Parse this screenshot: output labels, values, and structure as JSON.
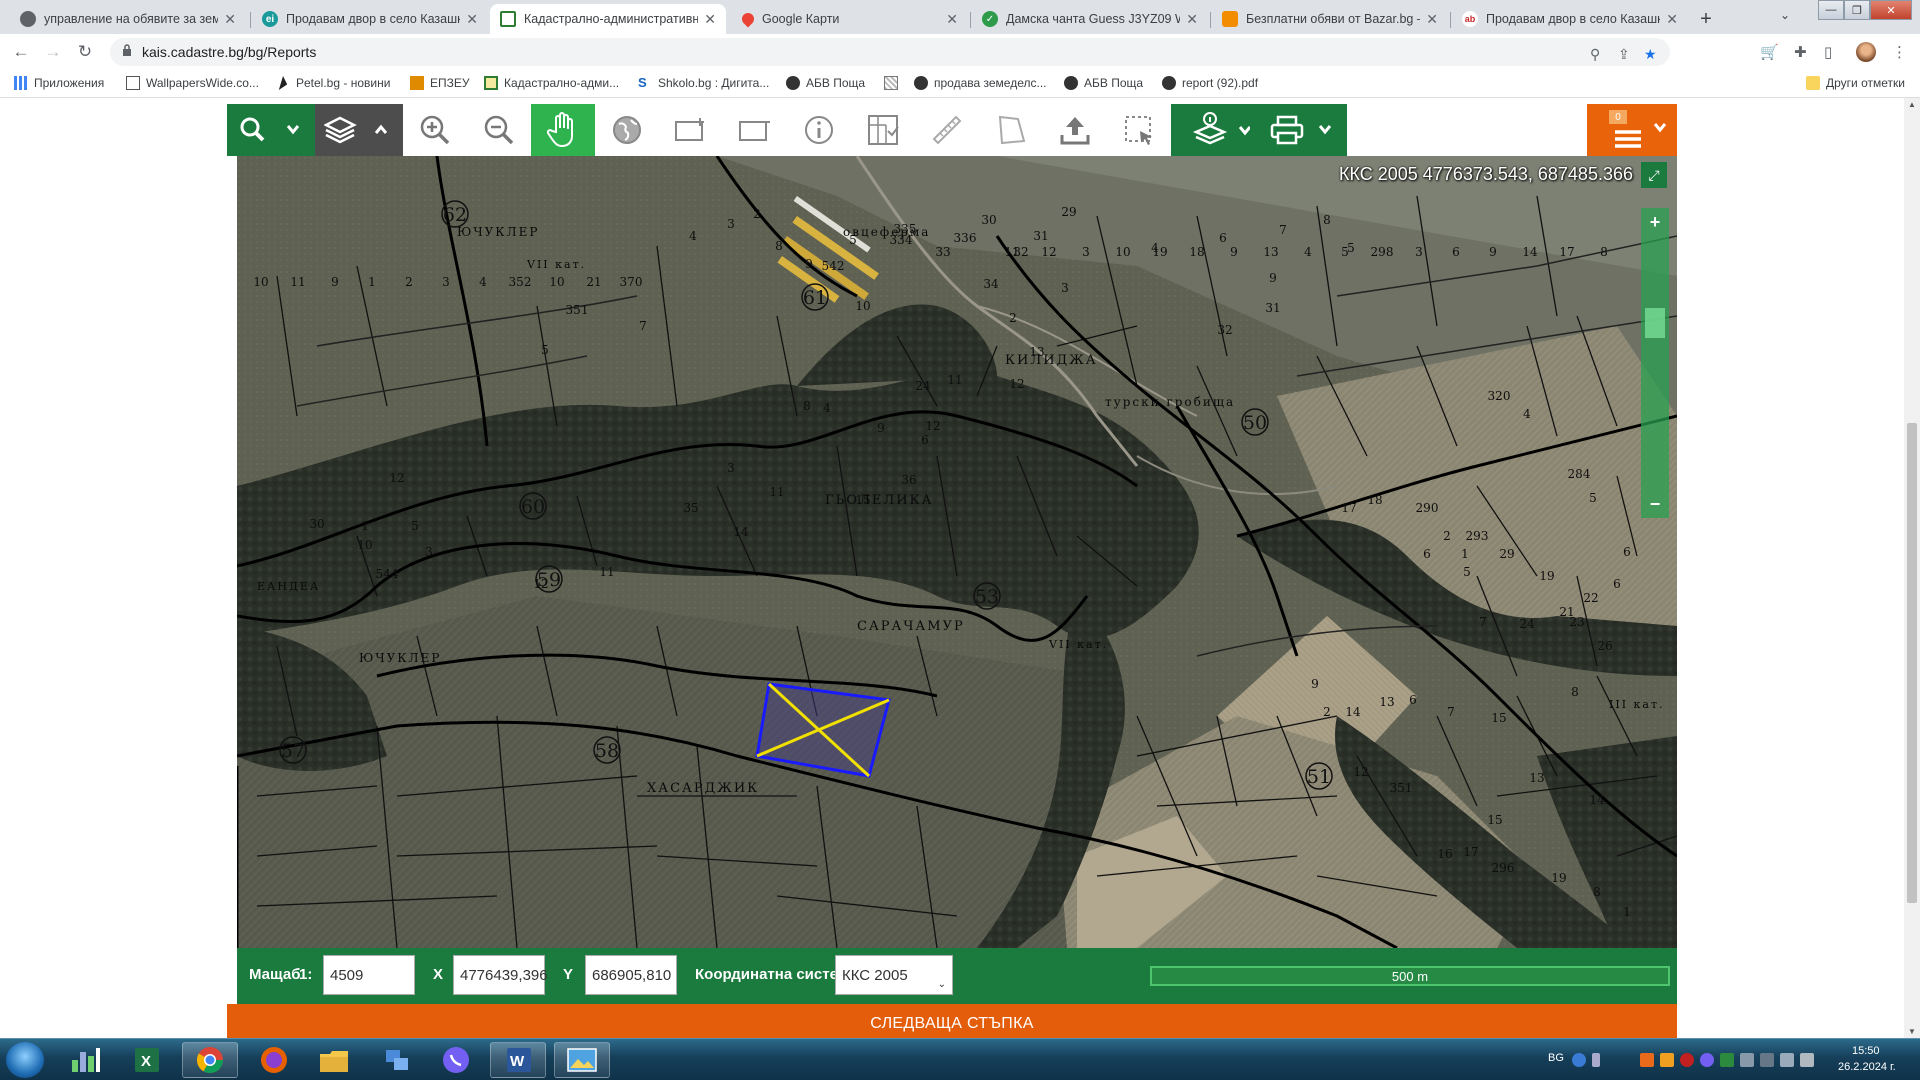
{
  "browser": {
    "tabs": [
      {
        "title": "управление на обявите за земе",
        "favicon_color": "#5f6368",
        "active": false
      },
      {
        "title": "Продавам двор в село Казашка",
        "favicon_color": "#1a9a9a",
        "active": false
      },
      {
        "title": "Кадастрално-административна",
        "favicon_color": "#2e7d32",
        "active": true
      },
      {
        "title": "Google Карти",
        "favicon_color": "#ea4335",
        "active": false
      },
      {
        "title": "Дамска чанта Guess J3YZ09 WF",
        "favicon_color": "#2e9b4a",
        "active": false
      },
      {
        "title": "Безплатни обяви от Bazar.bg – с",
        "favicon_color": "#f28c00",
        "active": false
      },
      {
        "title": "Продавам двор в село Казашка",
        "favicon_color": "#c62828",
        "active": false
      }
    ],
    "new_tab": "+",
    "url": "kais.cadastre.bg/bg/Reports",
    "bookmarks": [
      {
        "label": "Приложения",
        "color": "#4285f4"
      },
      {
        "label": "WallpapersWide.co...",
        "color": "#555555"
      },
      {
        "label": "Petel.bg - новини",
        "color": "#222222"
      },
      {
        "label": "ЕПЗЕУ",
        "color": "#e08a00"
      },
      {
        "label": "Кадастрално-адми...",
        "color": "#2e7d32"
      },
      {
        "label": "Shkolo.bg : Дигита...",
        "color": "#1565c0"
      },
      {
        "label": "АБВ Поща",
        "color": "#333333"
      },
      {
        "label": "",
        "color": "#777777"
      },
      {
        "label": "продава земеделс...",
        "color": "#333333"
      },
      {
        "label": "АБВ Поща",
        "color": "#333333"
      },
      {
        "label": "report (92).pdf",
        "color": "#333333"
      }
    ],
    "other_bookmarks": "Други отметки"
  },
  "map": {
    "toolbar_counter": "0",
    "coordinate_readout": "ККС 2005 4776373.543, 687485.366",
    "zoom_in": "+",
    "zoom_out": "−",
    "labels": [
      {
        "t": "ЮЧУКЛЕР"
      },
      {
        "t": "VII кат."
      },
      {
        "t": "овцеферма"
      },
      {
        "t": "КИЛИДЖА"
      },
      {
        "t": "турски гробища"
      },
      {
        "t": "ГЬОЛЕЛИКА"
      },
      {
        "t": "САРАЧАМУР"
      },
      {
        "t": "ЮЧУКЛЕР"
      },
      {
        "t": "ХАСАРДЖИК"
      },
      {
        "t": "VII кат."
      },
      {
        "t": "III кат."
      },
      {
        "t": "ЕАНДЕА"
      }
    ],
    "block_numbers": [
      "62",
      "61",
      "60",
      "59",
      "50",
      "53",
      "58",
      "57",
      "51"
    ],
    "parcel_numbers": [
      {
        "t": "2"
      },
      {
        "t": "3"
      },
      {
        "t": "4"
      },
      {
        "t": "5"
      },
      {
        "t": "8"
      },
      {
        "t": "9"
      },
      {
        "t": "335"
      },
      {
        "t": "334"
      },
      {
        "t": "336"
      },
      {
        "t": "33"
      },
      {
        "t": "30"
      },
      {
        "t": "29"
      },
      {
        "t": "31"
      },
      {
        "t": "32"
      },
      {
        "t": "6"
      },
      {
        "t": "7"
      },
      {
        "t": "8"
      },
      {
        "t": "542"
      },
      {
        "t": "10"
      },
      {
        "t": "34"
      },
      {
        "t": "2"
      },
      {
        "t": "3"
      },
      {
        "t": "4"
      },
      {
        "t": "5"
      },
      {
        "t": "9"
      },
      {
        "t": "31"
      },
      {
        "t": "32"
      },
      {
        "t": "11"
      },
      {
        "t": "12"
      },
      {
        "t": "13"
      },
      {
        "t": "12"
      },
      {
        "t": "351"
      },
      {
        "t": "5"
      },
      {
        "t": "7"
      },
      {
        "t": "8"
      },
      {
        "t": "9"
      },
      {
        "t": "24"
      },
      {
        "t": "6"
      },
      {
        "t": "320"
      },
      {
        "t": "4"
      },
      {
        "t": "284"
      },
      {
        "t": "5"
      },
      {
        "t": "12"
      },
      {
        "t": "3"
      },
      {
        "t": "4"
      },
      {
        "t": "11"
      },
      {
        "t": "14"
      },
      {
        "t": "15"
      },
      {
        "t": "35"
      },
      {
        "t": "36"
      },
      {
        "t": "17"
      },
      {
        "t": "18"
      },
      {
        "t": "290"
      },
      {
        "t": "6"
      },
      {
        "t": "2"
      },
      {
        "t": "293"
      },
      {
        "t": "1"
      },
      {
        "t": "5"
      },
      {
        "t": "29"
      },
      {
        "t": "19"
      },
      {
        "t": "30"
      },
      {
        "t": "10"
      },
      {
        "t": "1"
      },
      {
        "t": "11"
      },
      {
        "t": "12"
      },
      {
        "t": "3"
      },
      {
        "t": "5"
      },
      {
        "t": "544"
      },
      {
        "t": "6"
      },
      {
        "t": "6"
      },
      {
        "t": "7"
      },
      {
        "t": "24"
      },
      {
        "t": "21"
      },
      {
        "t": "22"
      },
      {
        "t": "23"
      },
      {
        "t": "26"
      },
      {
        "t": "8"
      },
      {
        "t": "9"
      },
      {
        "t": "2"
      },
      {
        "t": "14"
      },
      {
        "t": "13"
      },
      {
        "t": "6"
      },
      {
        "t": "7"
      },
      {
        "t": "15"
      },
      {
        "t": "351"
      },
      {
        "t": "12"
      },
      {
        "t": "13"
      },
      {
        "t": "14"
      },
      {
        "t": "15"
      },
      {
        "t": "16"
      },
      {
        "t": "17"
      },
      {
        "t": "296"
      },
      {
        "t": "19"
      },
      {
        "t": "8"
      },
      {
        "t": "1"
      },
      {
        "t": "11"
      },
      {
        "t": "12"
      },
      {
        "t": "3"
      },
      {
        "t": "10"
      },
      {
        "t": "19"
      },
      {
        "t": "18"
      },
      {
        "t": "9"
      },
      {
        "t": "13"
      },
      {
        "t": "4"
      },
      {
        "t": "5"
      },
      {
        "t": "298"
      },
      {
        "t": "3"
      },
      {
        "t": "6"
      },
      {
        "t": "9"
      },
      {
        "t": "14"
      },
      {
        "t": "17"
      },
      {
        "t": "8"
      },
      {
        "t": "10"
      },
      {
        "t": "11"
      },
      {
        "t": "9"
      },
      {
        "t": "1"
      },
      {
        "t": "2"
      },
      {
        "t": "3"
      },
      {
        "t": "4"
      },
      {
        "t": "352"
      },
      {
        "t": "10"
      },
      {
        "t": "21"
      },
      {
        "t": "370"
      }
    ]
  },
  "statusbar": {
    "scale_label": "Мащаб",
    "scale_prefix": "1:",
    "scale_value": "4509",
    "x_label": "X",
    "x_value": "4776439,396",
    "y_label": "Y",
    "y_value": "686905,810",
    "crs_label": "Координатна система",
    "crs_value": "ККС 2005",
    "scalebar_text": "500 m"
  },
  "next_step": "СЛЕДВАЩА СТЪПКА",
  "taskbar": {
    "lang": "BG",
    "time": "15:50",
    "date": "26.2.2024 г."
  }
}
